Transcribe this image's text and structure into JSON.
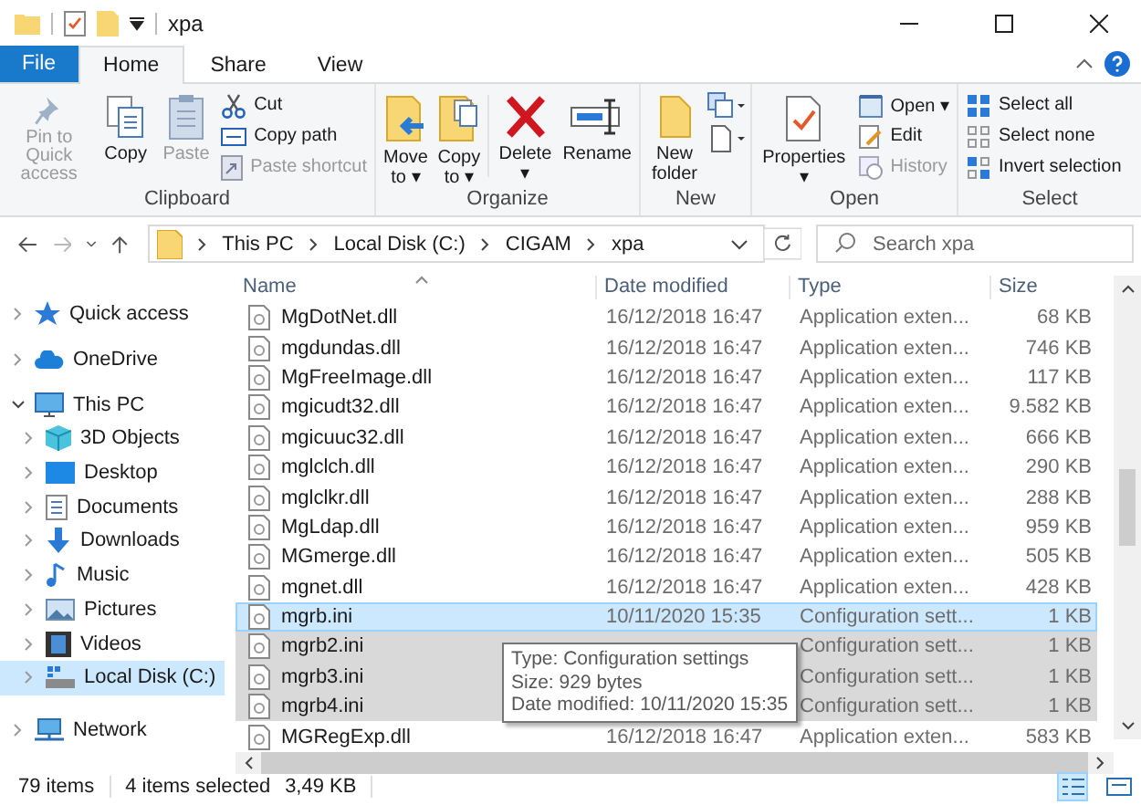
{
  "window": {
    "title": "xpa"
  },
  "ribbon_tabs": [
    {
      "label": "File",
      "kind": "file",
      "selected": false
    },
    {
      "label": "Home",
      "kind": "tab",
      "selected": true
    },
    {
      "label": "Share",
      "kind": "tab",
      "selected": false
    },
    {
      "label": "View",
      "kind": "tab",
      "selected": false
    }
  ],
  "ribbon": {
    "clipboard": {
      "label": "Clipboard",
      "pin": {
        "label": "Pin to Quick access",
        "disabled": true
      },
      "copy": {
        "label": "Copy",
        "disabled": false
      },
      "paste": {
        "label": "Paste",
        "disabled": true
      },
      "cut": {
        "label": "Cut",
        "disabled": false
      },
      "copy_path": {
        "label": "Copy path",
        "disabled": false
      },
      "paste_shortcut": {
        "label": "Paste shortcut",
        "disabled": true
      }
    },
    "organize": {
      "label": "Organize",
      "move_to": {
        "label": "Move to",
        "caret": "▾"
      },
      "copy_to": {
        "label": "Copy to",
        "caret": "▾"
      },
      "delete": {
        "label": "Delete",
        "caret": "▾"
      },
      "rename": {
        "label": "Rename"
      }
    },
    "new": {
      "label": "New",
      "new_folder": {
        "label": "New folder"
      }
    },
    "open": {
      "label": "Open",
      "properties": {
        "label": "Properties",
        "caret": "▾"
      },
      "open": {
        "label": "Open",
        "caret": "▾",
        "disabled": false
      },
      "edit": {
        "label": "Edit",
        "disabled": false
      },
      "history": {
        "label": "History",
        "disabled": true
      }
    },
    "select": {
      "label": "Select",
      "select_all": {
        "label": "Select all"
      },
      "select_none": {
        "label": "Select none"
      },
      "invert": {
        "label": "Invert selection"
      }
    }
  },
  "address": {
    "path": [
      "This PC",
      "Local Disk (C:)",
      "CIGAM",
      "xpa"
    ]
  },
  "search": {
    "placeholder": "Search xpa"
  },
  "sidebar": {
    "items": [
      {
        "label": "Quick access",
        "expanded": false,
        "selected": false
      },
      {
        "label": "OneDrive",
        "expanded": false,
        "selected": false
      },
      {
        "label": "This PC",
        "expanded": true,
        "selected": false,
        "children": [
          {
            "label": "3D Objects",
            "expanded": false,
            "selected": false
          },
          {
            "label": "Desktop",
            "expanded": false,
            "selected": false
          },
          {
            "label": "Documents",
            "expanded": false,
            "selected": false
          },
          {
            "label": "Downloads",
            "expanded": false,
            "selected": false
          },
          {
            "label": "Music",
            "expanded": false,
            "selected": false
          },
          {
            "label": "Pictures",
            "expanded": false,
            "selected": false
          },
          {
            "label": "Videos",
            "expanded": false,
            "selected": false
          },
          {
            "label": "Local Disk (C:)",
            "expanded": false,
            "selected": true
          }
        ]
      },
      {
        "label": "Network",
        "expanded": false,
        "selected": false
      }
    ]
  },
  "table": {
    "columns": [
      "Name",
      "Date modified",
      "Type",
      "Size"
    ],
    "rows": [
      {
        "name": "MgDotNet.dll",
        "date": "16/12/2018 16:47",
        "type": "Application exten...",
        "size": "68 KB",
        "selected": false,
        "hovered": false
      },
      {
        "name": "mgdundas.dll",
        "date": "16/12/2018 16:47",
        "type": "Application exten...",
        "size": "746 KB",
        "selected": false,
        "hovered": false
      },
      {
        "name": "MgFreeImage.dll",
        "date": "16/12/2018 16:47",
        "type": "Application exten...",
        "size": "117 KB",
        "selected": false,
        "hovered": false
      },
      {
        "name": "mgicudt32.dll",
        "date": "16/12/2018 16:47",
        "type": "Application exten...",
        "size": "9.582 KB",
        "selected": false,
        "hovered": false
      },
      {
        "name": "mgicuuc32.dll",
        "date": "16/12/2018 16:47",
        "type": "Application exten...",
        "size": "666 KB",
        "selected": false,
        "hovered": false
      },
      {
        "name": "mglclch.dll",
        "date": "16/12/2018 16:47",
        "type": "Application exten...",
        "size": "290 KB",
        "selected": false,
        "hovered": false
      },
      {
        "name": "mglclkr.dll",
        "date": "16/12/2018 16:47",
        "type": "Application exten...",
        "size": "288 KB",
        "selected": false,
        "hovered": false
      },
      {
        "name": "MgLdap.dll",
        "date": "16/12/2018 16:47",
        "type": "Application exten...",
        "size": "959 KB",
        "selected": false,
        "hovered": false
      },
      {
        "name": "MGmerge.dll",
        "date": "16/12/2018 16:47",
        "type": "Application exten...",
        "size": "505 KB",
        "selected": false,
        "hovered": false
      },
      {
        "name": "mgnet.dll",
        "date": "16/12/2018 16:47",
        "type": "Application exten...",
        "size": "428 KB",
        "selected": false,
        "hovered": false
      },
      {
        "name": "mgrb.ini",
        "date": "10/11/2020 15:35",
        "type": "Configuration sett...",
        "size": "1 KB",
        "selected": true,
        "hovered": true
      },
      {
        "name": "mgrb2.ini",
        "type": "Configuration sett...",
        "size": "1 KB",
        "selected": true,
        "hovered": false
      },
      {
        "name": "mgrb3.ini",
        "type": "Configuration sett...",
        "size": "1 KB",
        "selected": true,
        "hovered": false
      },
      {
        "name": "mgrb4.ini",
        "type": "Configuration sett...",
        "size": "1 KB",
        "selected": true,
        "hovered": false
      },
      {
        "name": "MGRegExp.dll",
        "date": "16/12/2018 16:47",
        "type": "Application exten...",
        "size": "583 KB",
        "selected": false,
        "hovered": false
      }
    ]
  },
  "tooltip": {
    "lines": [
      "Type: Configuration settings",
      "Size: 929 bytes",
      "Date modified: 10/11/2020 15:35"
    ]
  },
  "status_bar": {
    "count": "79 items",
    "selected": "4 items selected",
    "size": "3,49 KB",
    "views": [
      {
        "kind": "details",
        "selected": true
      },
      {
        "kind": "tiles",
        "selected": false
      }
    ]
  }
}
